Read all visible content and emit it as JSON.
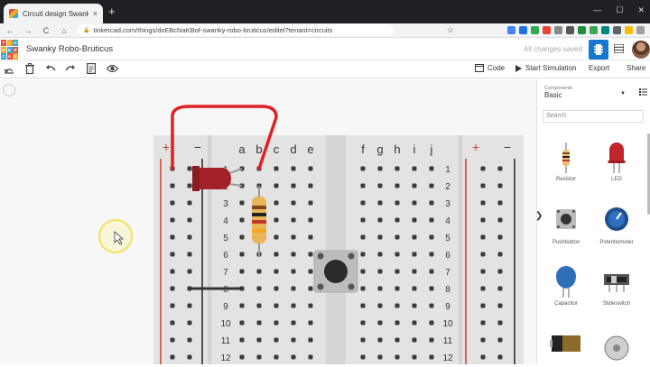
{
  "browser": {
    "tab_title": "Circuit design Swanky Robo-Bruticus",
    "url": "tinkercad.com/things/dxEBcNaKBof-swanky-robo-bruticus/editel?tenant=circuits",
    "close_glyph": "×",
    "newtab_glyph": "+",
    "back_glyph": "←",
    "forward_glyph": "→",
    "reload_glyph": "C",
    "home_glyph": "⌂",
    "lock_glyph": "🔒",
    "star_glyph": "☆",
    "minimize_glyph": "—",
    "maximize_glyph": "☐",
    "close_window_glyph": "✕",
    "ext_colors": [
      "#4285f4",
      "#1a73e8",
      "#34a853",
      "#ea4335",
      "#888888",
      "#555555",
      "#1e8e3e",
      "#34a853",
      "#00897b",
      "#5f6368",
      "#fbbc04",
      "#9e9e9e"
    ]
  },
  "app": {
    "logo_letters": [
      "TIN",
      "KER",
      "CAD"
    ],
    "logo_colors": [
      "#e94f3c",
      "#f5a623",
      "#2ea8df",
      "#f5a623",
      "#2ea8df",
      "#e94f3c",
      "#2ea8df",
      "#e94f3c",
      "#f5a623"
    ],
    "logo_cells": [
      "T",
      "I",
      "N",
      "K",
      "E",
      "R",
      "C",
      "A",
      "D"
    ],
    "design_name": "Swanky Robo-Bruticus",
    "save_status": "All changes saved"
  },
  "toolbar": {
    "code_label": "Code",
    "start_simulation_label": "Start Simulation",
    "export_label": "Export",
    "share_label": "Share"
  },
  "breadboard": {
    "left_columns": [
      "a",
      "b",
      "c",
      "d",
      "e"
    ],
    "right_columns": [
      "f",
      "g",
      "h",
      "i",
      "j"
    ],
    "rows": [
      "1",
      "2",
      "3",
      "4",
      "5",
      "6",
      "7",
      "8",
      "9",
      "10",
      "11",
      "12"
    ],
    "plus_label": "+",
    "minus_label": "−",
    "plus_color": "#d03a2c",
    "minus_color": "#222222",
    "wire_color": "#e02020"
  },
  "components_panel": {
    "label": "Components",
    "selected": "Basic",
    "search_placeholder": "Search",
    "items": [
      "Resistor",
      "LED",
      "Pushbutton",
      "Potentiometer",
      "Capacitor",
      "Slideswitch"
    ]
  }
}
